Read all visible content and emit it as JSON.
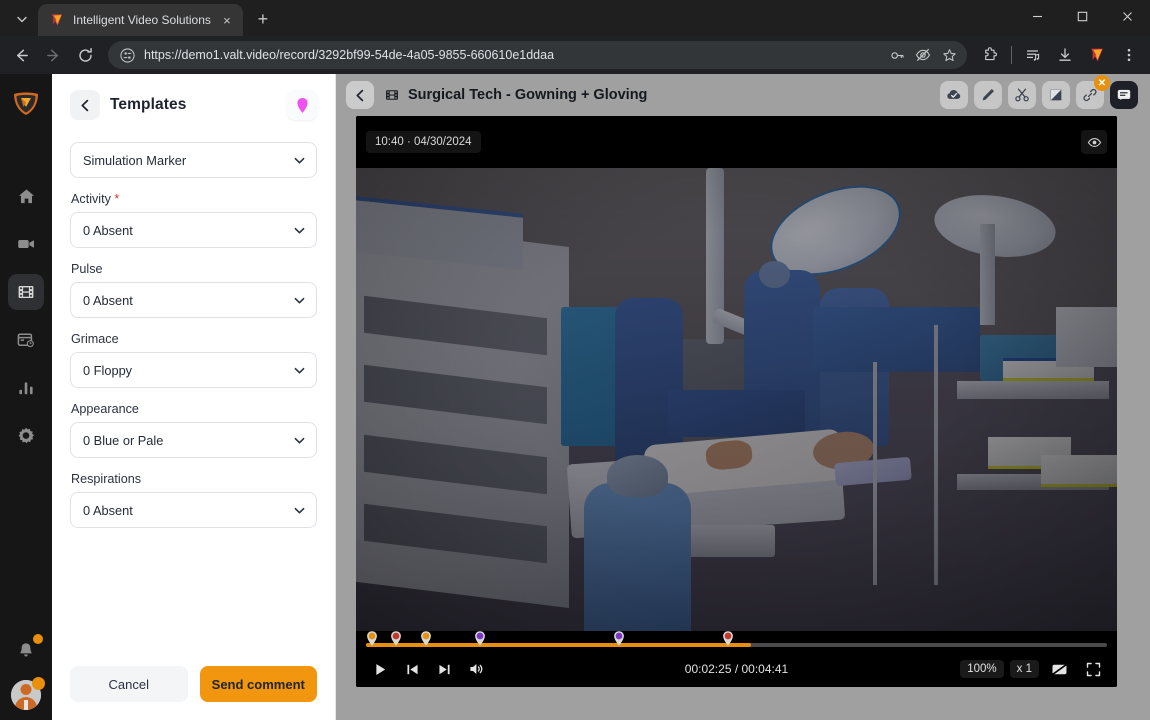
{
  "browser": {
    "tab": {
      "title": "Intelligent Video Solutions",
      "favicon": "ivs-logo-icon",
      "close": "×"
    },
    "new_tab_label": "+",
    "tab_list_icon": "chevron-down-icon",
    "window": {
      "minimize": "—",
      "maximize": "▢",
      "close": "✕"
    },
    "nav": {
      "back": "back-arrow-icon",
      "forward": "forward-arrow-icon",
      "reload": "reload-icon"
    },
    "omnibox": {
      "url": "https://demo1.valt.video/record/3292bf99-54de-4a05-9855-660610e1ddaa",
      "site_icon": "site-settings-icon",
      "actions": [
        "password-key-icon",
        "eye-slash-icon",
        "bookmark-star-icon"
      ]
    },
    "toolbar_right": [
      "extensions-puzzle-icon",
      "reading-list-icon",
      "downloads-icon",
      "profile-logo-icon",
      "three-dot-menu-icon"
    ]
  },
  "rail": {
    "logo": "valt-shield-logo",
    "items": [
      {
        "name": "home",
        "icon": "home-icon",
        "active": false
      },
      {
        "name": "live",
        "icon": "video-camera-icon",
        "active": false
      },
      {
        "name": "recordings",
        "icon": "film-strip-icon",
        "active": true
      },
      {
        "name": "scheduling",
        "icon": "calendar-clock-icon",
        "active": false
      },
      {
        "name": "analytics",
        "icon": "bar-chart-icon",
        "active": false
      },
      {
        "name": "settings",
        "icon": "gear-icon",
        "active": false
      }
    ],
    "notifications": {
      "icon": "bell-icon",
      "badge": true
    },
    "avatar": {
      "icon": "user-avatar",
      "badge": true
    }
  },
  "panel": {
    "back_icon": "chevron-left-icon",
    "title": "Templates",
    "marker_icon": "map-pin-marker-icon",
    "template_select": {
      "label": "",
      "value": "Simulation Marker",
      "chevron": "chevron-down-icon"
    },
    "fields": [
      {
        "label": "Activity",
        "required": true,
        "value": "0 Absent"
      },
      {
        "label": "Pulse",
        "required": false,
        "value": "0 Absent"
      },
      {
        "label": "Grimace",
        "required": false,
        "value": "0 Floppy"
      },
      {
        "label": "Appearance",
        "required": false,
        "value": "0 Blue or Pale"
      },
      {
        "label": "Respirations",
        "required": false,
        "value": "0 Absent"
      }
    ],
    "required_mark": "*",
    "cancel_label": "Cancel",
    "send_label": "Send comment"
  },
  "viewer": {
    "back_icon": "chevron-left-icon",
    "title_icon": "film-strip-icon",
    "title": "Surgical Tech - Gowning + Gloving",
    "tools": [
      {
        "name": "cloud-check",
        "icon": "cloud-check-icon",
        "active": false,
        "badge": null
      },
      {
        "name": "annotate",
        "icon": "pen-icon",
        "active": false,
        "badge": null
      },
      {
        "name": "clip",
        "icon": "scissors-icon",
        "active": false,
        "badge": null
      },
      {
        "name": "bookmark",
        "icon": "flag-tag-icon",
        "active": false,
        "badge": null
      },
      {
        "name": "share-link",
        "icon": "link-icon",
        "active": false,
        "badge": "✕"
      },
      {
        "name": "comments",
        "icon": "comment-icon",
        "active": true,
        "badge": null
      }
    ],
    "overlay": {
      "timestamp": "10:40 · 04/30/2024",
      "eye_icon": "eye-icon"
    },
    "controls": {
      "play_icon": "play-icon",
      "prev_icon": "skip-previous-icon",
      "next_icon": "skip-next-icon",
      "volume_icon": "volume-icon",
      "current_time": "00:02:25",
      "duration": "00:04:41",
      "time_display": "00:02:25 / 00:04:41",
      "zoom_level": "100%",
      "speed": "x 1",
      "captions_icon": "captions-off-icon",
      "fullscreen_icon": "fullscreen-icon",
      "progress_percent": 52,
      "markers": [
        {
          "position_percent": 0.8,
          "color": "#e8900c"
        },
        {
          "position_percent": 4.0,
          "color": "#c0392b"
        },
        {
          "position_percent": 7.9,
          "color": "#e8900c"
        },
        {
          "position_percent": 15.0,
          "color": "#7b35c9"
        },
        {
          "position_percent": 33.2,
          "color": "#7b35c9"
        },
        {
          "position_percent": 47.6,
          "color": "#c0392b"
        }
      ]
    }
  },
  "colors": {
    "accent_orange": "#f2950f",
    "marker_pink": "#ef52ef",
    "required_red": "#e0342b",
    "badge_orange": "#e8900c"
  }
}
